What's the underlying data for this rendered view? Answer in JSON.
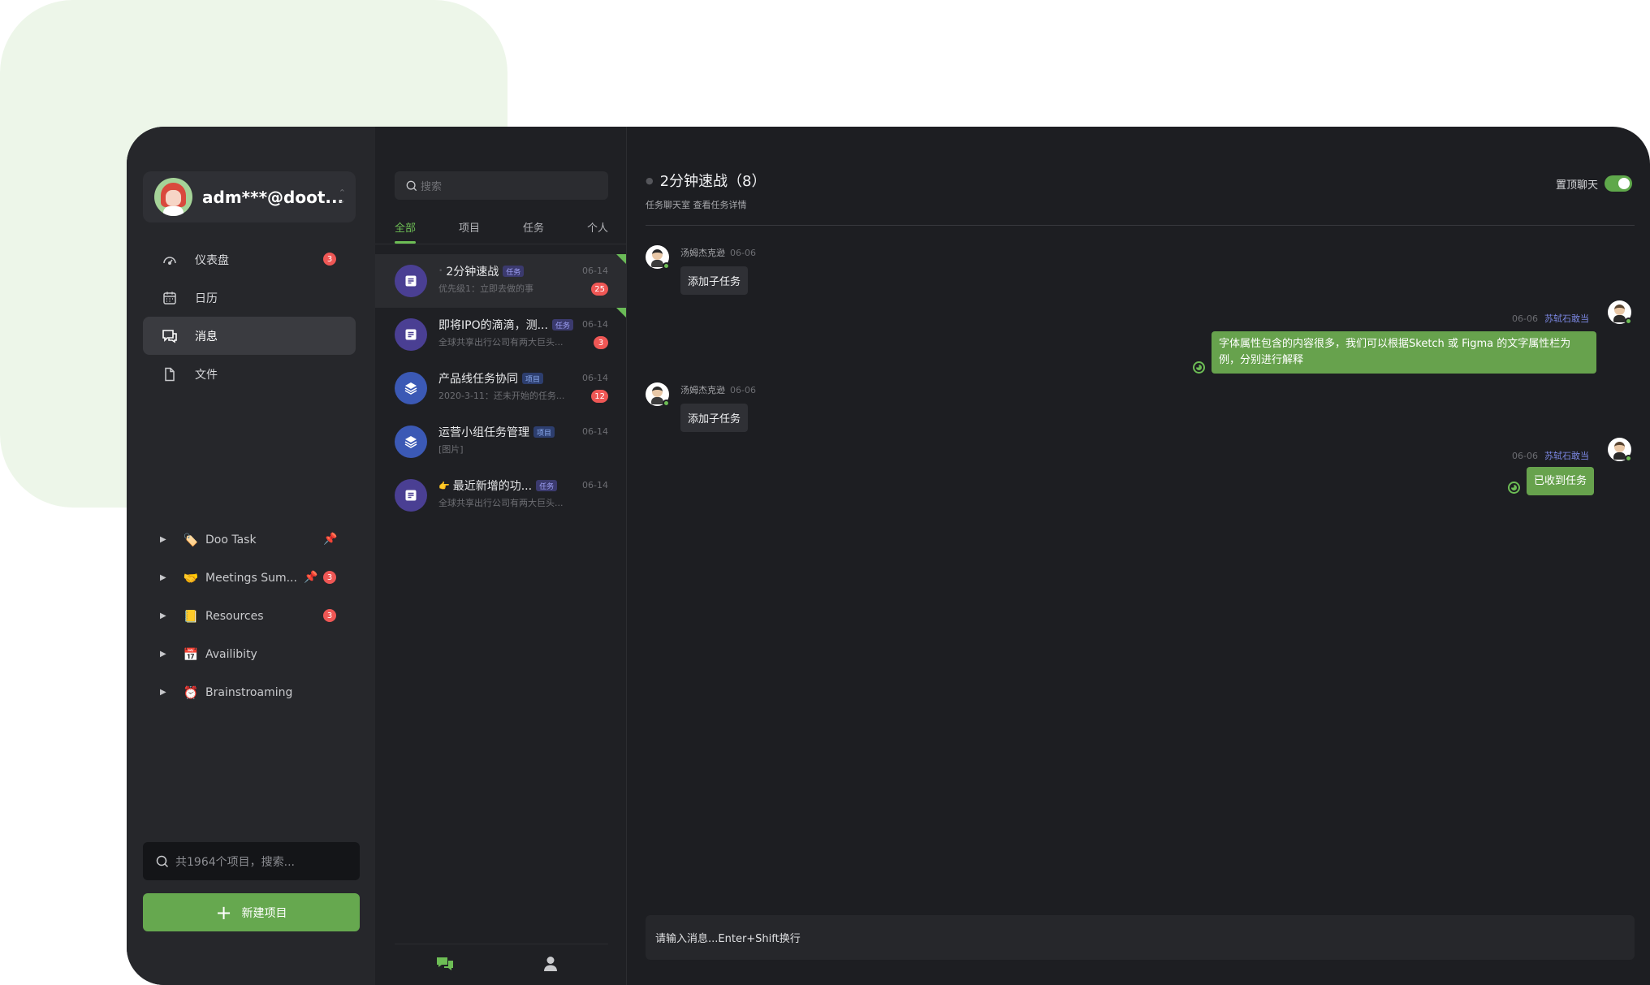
{
  "user": {
    "name": "adm***@doot..."
  },
  "nav": [
    {
      "label": "仪表盘",
      "badge": "3",
      "icon": "dashboard-icon"
    },
    {
      "label": "日历",
      "badge": "",
      "icon": "calendar-icon"
    },
    {
      "label": "消息",
      "badge": "",
      "icon": "chat-icon"
    },
    {
      "label": "文件",
      "badge": "",
      "icon": "file-icon"
    }
  ],
  "projects": [
    {
      "label": "Doo Task",
      "emoji": "🏷️",
      "pinned": true,
      "badge": ""
    },
    {
      "label": "Meetings Sum...",
      "emoji": "🤝",
      "pinned": true,
      "badge": "3"
    },
    {
      "label": "Resources",
      "emoji": "📒",
      "pinned": false,
      "badge": "3"
    },
    {
      "label": "Availibity",
      "emoji": "📅",
      "pinned": false,
      "badge": ""
    },
    {
      "label": "Brainstroaming",
      "emoji": "⏰",
      "pinned": false,
      "badge": ""
    }
  ],
  "sidebar_search": {
    "placeholder": "共1964个项目，搜索..."
  },
  "new_project": {
    "label": "新建项目"
  },
  "middle": {
    "search_placeholder": "搜索",
    "tabs": [
      "全部",
      "项目",
      "任务",
      "个人"
    ],
    "conversations": [
      {
        "title": "2分钟速战",
        "tag": "任务",
        "tag_type": "task",
        "sub": "优先级1：立即去做的事",
        "date": "06-14",
        "badge": "25",
        "avatar": "task",
        "active": true,
        "corner": true,
        "prefix": "•"
      },
      {
        "title": "即将IPO的滴滴，测...",
        "tag": "任务",
        "tag_type": "task",
        "sub": "全球共享出行公司有两大巨头...",
        "date": "06-14",
        "badge": "3",
        "avatar": "task",
        "active": false,
        "corner": true,
        "prefix": ""
      },
      {
        "title": "产品线任务协同",
        "tag": "项目",
        "tag_type": "proj",
        "sub": "2020-3-11：还未开始的任务...",
        "date": "06-14",
        "badge": "12",
        "avatar": "project",
        "active": false,
        "corner": false,
        "prefix": ""
      },
      {
        "title": "运营小组任务管理",
        "tag": "项目",
        "tag_type": "proj",
        "sub": "[图片]",
        "date": "06-14",
        "badge": "",
        "avatar": "project",
        "active": false,
        "corner": false,
        "prefix": ""
      },
      {
        "title": "最近新增的功...",
        "tag": "任务",
        "tag_type": "task",
        "sub": "全球共享出行公司有两大巨头...",
        "date": "06-14",
        "badge": "",
        "avatar": "task",
        "active": false,
        "corner": false,
        "prefix": "👉"
      }
    ]
  },
  "chat": {
    "title": "2分钟速战（8）",
    "subtitle": "任务聊天室 查看任务详情",
    "pin_label": "置顶聊天",
    "messages": [
      {
        "side": "left",
        "name": "汤姆杰克逊",
        "time": "06-06",
        "text": "添加子任务"
      },
      {
        "side": "right",
        "name": "苏轼石敢当",
        "time": "06-06",
        "text": "字体属性包含的内容很多，我们可以根据Sketch 或 Figma 的文字属性栏为例，分别进行解释"
      },
      {
        "side": "left",
        "name": "汤姆杰克逊",
        "time": "06-06",
        "text": "添加子任务"
      },
      {
        "side": "right",
        "name": "苏轼石敢当",
        "time": "06-06",
        "text": "已收到任务"
      }
    ],
    "input_placeholder": "请输入消息...Enter+Shift换行"
  },
  "colors": {
    "accent": "#66a84f",
    "badge": "#ef5755",
    "panel": "#1d1e22",
    "sidebar": "#26272b"
  }
}
